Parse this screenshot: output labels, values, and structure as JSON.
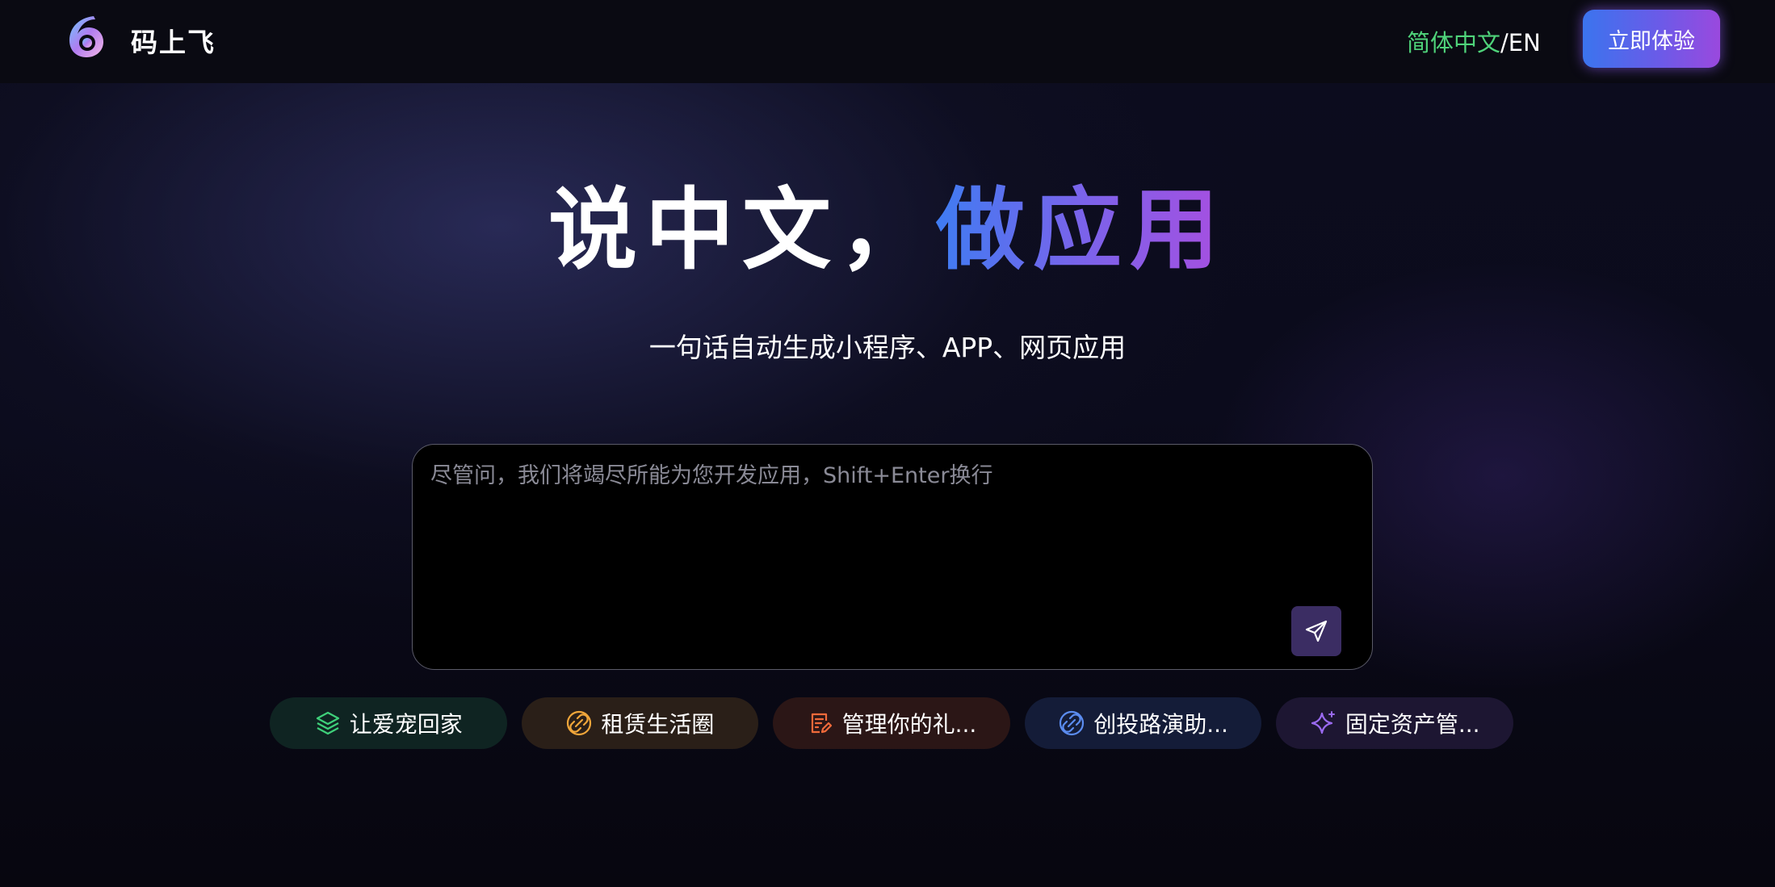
{
  "header": {
    "brand": "码上飞",
    "lang_zh": "简体中文",
    "lang_sep": "/",
    "lang_en": "EN",
    "try_button": "立即体验"
  },
  "hero": {
    "headline_part1": "说中文，",
    "headline_part2": "做应用",
    "subtitle": "一句话自动生成小程序、APP、网页应用"
  },
  "prompt": {
    "value": "",
    "placeholder": "尽管问，我们将竭尽所能为您开发应用，Shift+Enter换行",
    "send_icon": "send-icon"
  },
  "suggestions": [
    {
      "label": "让爱宠回家",
      "icon": "layers-icon",
      "color": "#3fd07a"
    },
    {
      "label": "租赁生活圈",
      "icon": "link-icon",
      "color": "#f0a63a"
    },
    {
      "label": "管理你的礼...",
      "icon": "edit-doc-icon",
      "color": "#f06a3a"
    },
    {
      "label": "创投路演助...",
      "icon": "link-icon",
      "color": "#5b8cf0"
    },
    {
      "label": "固定资产管...",
      "icon": "sparkle-icon",
      "color": "#9a6af0"
    }
  ],
  "colors": {
    "accent_green": "#4fd37a",
    "gradient_start": "#3b74ee",
    "gradient_end": "#9a49de",
    "background": "#0b0b1c"
  }
}
